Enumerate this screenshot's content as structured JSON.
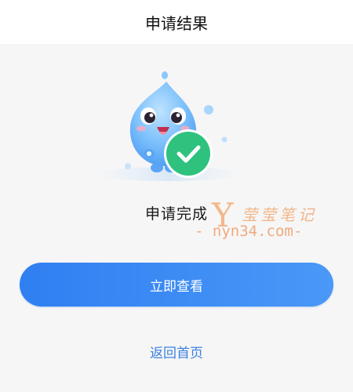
{
  "header": {
    "title": "申请结果"
  },
  "result": {
    "status_text": "申请完成"
  },
  "actions": {
    "primary_label": "立即查看",
    "secondary_label": "返回首页"
  },
  "watermark": {
    "logo_letter": "Y",
    "site_name": "莹莹笔记",
    "url": "- nyn34.com-"
  },
  "icons": {
    "mascot": "water-drop-mascot-illustration",
    "badge": "check-circle-icon"
  },
  "colors": {
    "accent": "#2f7ff2",
    "accent_light": "#4a98f7",
    "success": "#2ec27e",
    "link": "#3b82e0",
    "watermark": "#f2b78a"
  }
}
